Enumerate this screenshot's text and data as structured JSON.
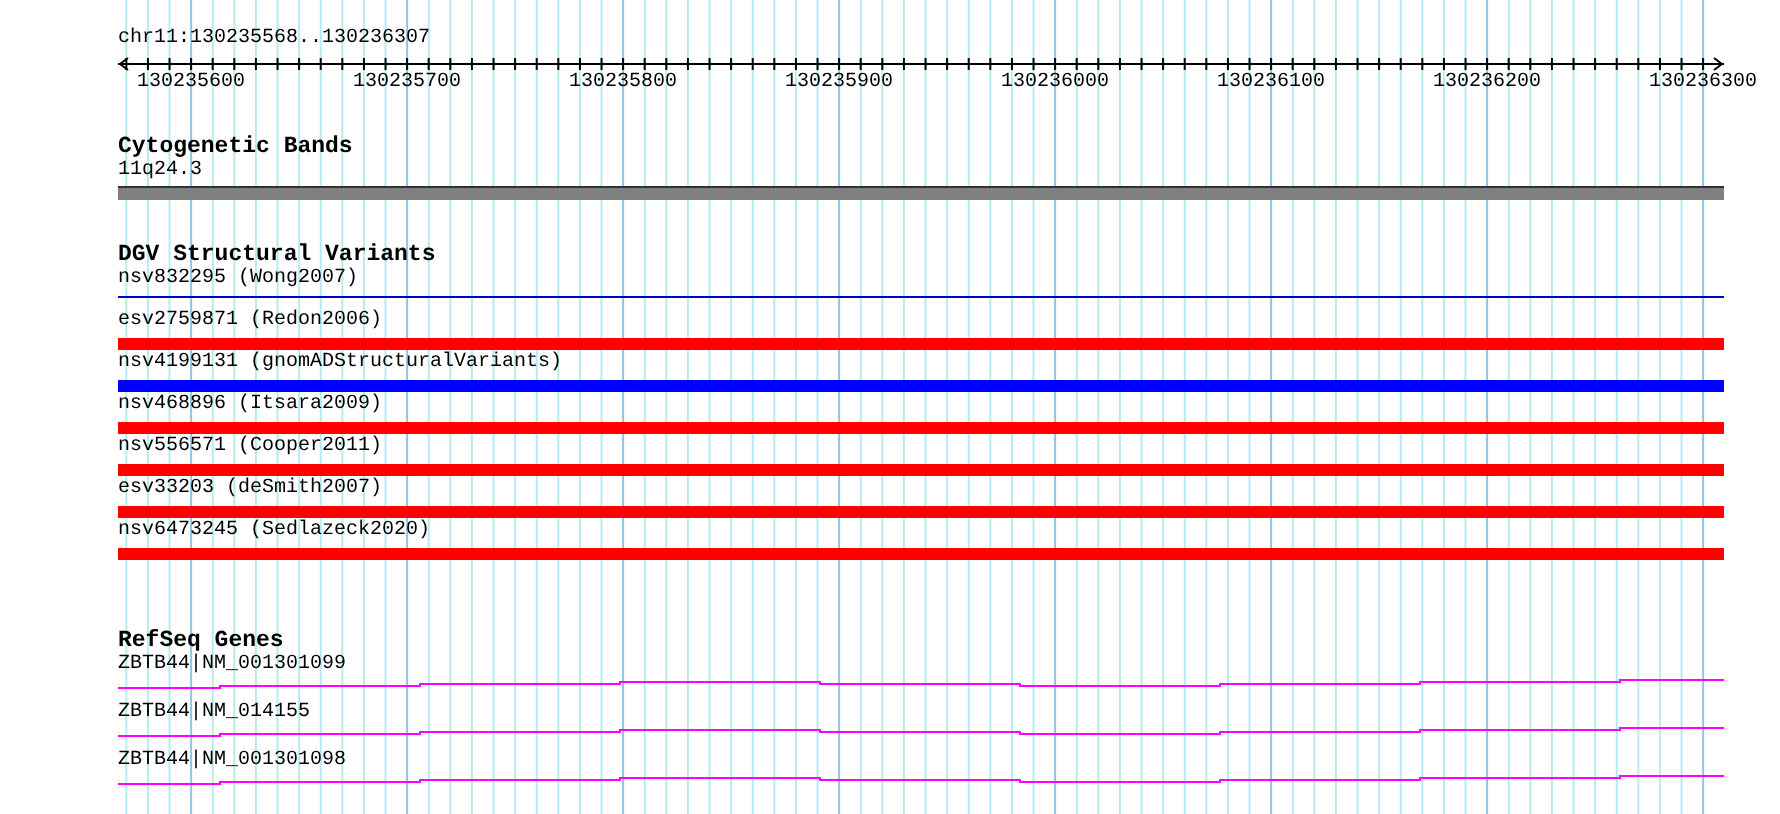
{
  "location": "chr11:130235568..130236307",
  "ruler": {
    "ticks": [
      "130235600",
      "130235700",
      "130235800",
      "130235900",
      "130236000",
      "130236100",
      "130236200",
      "130236300"
    ]
  },
  "tracks": [
    {
      "kind": "bands",
      "title": "Cytogenetic Bands",
      "features": [
        {
          "label": "11q24.3"
        }
      ]
    },
    {
      "kind": "variants",
      "title": "DGV Structural Variants",
      "features": [
        {
          "label": "nsv832295 (Wong2007)",
          "kind": "line",
          "color": "#0000cc"
        },
        {
          "label": "esv2759871 (Redon2006)",
          "kind": "bar",
          "color": "#ff0000"
        },
        {
          "label": "nsv4199131 (gnomADStructuralVariants)",
          "kind": "bar",
          "color": "#0000ff"
        },
        {
          "label": "nsv468896 (Itsara2009)",
          "kind": "bar",
          "color": "#ff0000"
        },
        {
          "label": "nsv556571 (Cooper2011)",
          "kind": "bar",
          "color": "#ff0000"
        },
        {
          "label": "esv33203 (deSmith2007)",
          "kind": "bar",
          "color": "#ff0000"
        },
        {
          "label": "nsv6473245 (Sedlazeck2020)",
          "kind": "bar",
          "color": "#ff0000"
        }
      ]
    },
    {
      "kind": "genes",
      "title": "RefSeq Genes",
      "features": [
        {
          "label": "ZBTB44|NM_001301099"
        },
        {
          "label": "ZBTB44|NM_014155"
        },
        {
          "label": "ZBTB44|NM_001301098"
        }
      ]
    }
  ]
}
